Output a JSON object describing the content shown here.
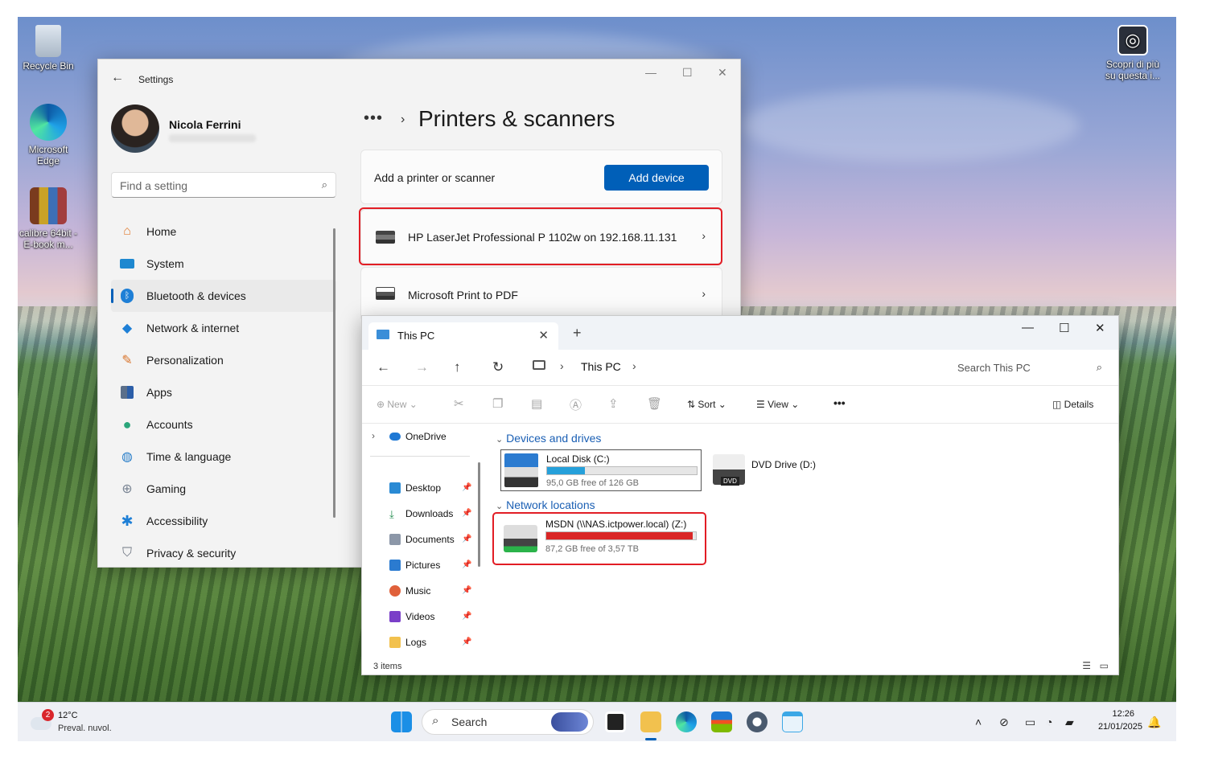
{
  "desktop": {
    "icons": [
      {
        "label": "Recycle Bin"
      },
      {
        "label": "Microsoft Edge"
      },
      {
        "label": "calibre 64bit - E-book m..."
      }
    ],
    "promo_label": "Scopri di più su questa i..."
  },
  "settings": {
    "window_title": "Settings",
    "user_name": "Nicola Ferrini",
    "search_placeholder": "Find a setting",
    "nav": [
      {
        "label": "Home",
        "icon": "home-icon"
      },
      {
        "label": "System",
        "icon": "system-icon"
      },
      {
        "label": "Bluetooth & devices",
        "icon": "bluetooth-icon",
        "active": true
      },
      {
        "label": "Network & internet",
        "icon": "wifi-icon"
      },
      {
        "label": "Personalization",
        "icon": "brush-icon"
      },
      {
        "label": "Apps",
        "icon": "apps-icon"
      },
      {
        "label": "Accounts",
        "icon": "accounts-icon"
      },
      {
        "label": "Time & language",
        "icon": "globe-icon"
      },
      {
        "label": "Gaming",
        "icon": "gamepad-icon"
      },
      {
        "label": "Accessibility",
        "icon": "accessibility-icon"
      },
      {
        "label": "Privacy & security",
        "icon": "shield-icon"
      }
    ],
    "breadcrumb_more": "•••",
    "page_title": "Printers & scanners",
    "add_label": "Add a printer or scanner",
    "add_button": "Add device",
    "printers": [
      {
        "name": "HP LaserJet Professional P 1102w on 192.168.11.131",
        "highlighted": true
      },
      {
        "name": "Microsoft Print to PDF",
        "highlighted": false
      }
    ],
    "accent": "#005fb8"
  },
  "explorer": {
    "tab_title": "This PC",
    "address": "This PC",
    "search_placeholder": "Search This PC",
    "commands": {
      "new": "New",
      "sort": "Sort",
      "view": "View",
      "details": "Details",
      "more": "•••"
    },
    "sidebar": [
      {
        "label": "OneDrive",
        "pinned": false
      },
      {
        "label": "Desktop",
        "pinned": true
      },
      {
        "label": "Downloads",
        "pinned": true
      },
      {
        "label": "Documents",
        "pinned": true
      },
      {
        "label": "Pictures",
        "pinned": true
      },
      {
        "label": "Music",
        "pinned": true
      },
      {
        "label": "Videos",
        "pinned": true
      },
      {
        "label": "Logs",
        "pinned": true
      }
    ],
    "groups": {
      "devices": "Devices and drives",
      "network": "Network locations"
    },
    "drives": {
      "c": {
        "name": "Local Disk (C:)",
        "free": "95,0 GB free of 126 GB",
        "used_fraction": 0.25,
        "fill_color": "#26a0da"
      },
      "d": {
        "name": "DVD Drive (D:)",
        "badge": "DVD"
      },
      "z": {
        "name": "MSDN (\\\\NAS.ictpower.local) (Z:)",
        "free": "87,2 GB free of 3,57 TB",
        "used_fraction": 0.976,
        "fill_color": "#da2626"
      }
    },
    "status": "3 items"
  },
  "taskbar": {
    "weather_temp": "12°C",
    "weather_desc": "Preval. nuvol.",
    "weather_badge": "2",
    "search_label": "Search",
    "time": "12:26",
    "date": "21/01/2025"
  }
}
